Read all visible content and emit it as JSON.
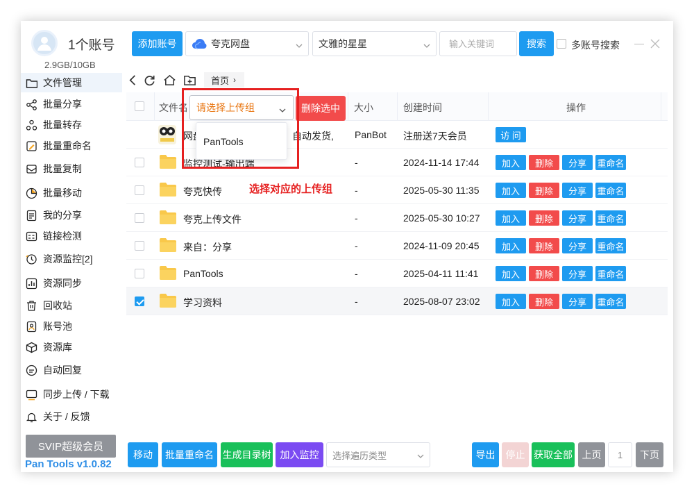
{
  "sidebar": {
    "account_count": "1个账号",
    "storage": "2.9GB/10GB",
    "items": [
      {
        "label": "文件管理",
        "icon": "folder-icon"
      },
      {
        "label": "批量分享",
        "icon": "share-icon"
      },
      {
        "label": "批量转存",
        "icon": "transfer-icon"
      },
      {
        "label": "批量重命名",
        "icon": "rename-icon"
      },
      {
        "label": "批量复制",
        "icon": "copy-icon"
      },
      {
        "label": "批量移动",
        "icon": "move-icon"
      },
      {
        "label": "我的分享",
        "icon": "my-share-icon"
      },
      {
        "label": "链接检测",
        "icon": "link-check-icon"
      },
      {
        "label": "资源监控[2]",
        "icon": "monitor-icon"
      },
      {
        "label": "资源同步",
        "icon": "sync-icon"
      },
      {
        "label": "回收站",
        "icon": "trash-icon"
      },
      {
        "label": "账号池",
        "icon": "account-pool-icon"
      },
      {
        "label": "资源库",
        "icon": "resource-icon"
      },
      {
        "label": "自动回复",
        "icon": "auto-reply-icon"
      },
      {
        "label": "同步上传 / 下载",
        "icon": "upload-download-icon"
      },
      {
        "label": "关于 / 反馈",
        "icon": "bell-icon"
      }
    ],
    "svip_label": "SVIP超级会员",
    "version": "Pan Tools v1.0.82"
  },
  "toolbar": {
    "add_account": "添加账号",
    "drive": "夸克网盘",
    "user": "文雅的星星",
    "keyword_placeholder": "输入关键词",
    "search": "搜索",
    "multi_account": "多账号搜索"
  },
  "breadcrumb": {
    "home": "首页"
  },
  "table": {
    "headers": {
      "name": "文件名",
      "size": "大小",
      "created": "创建时间",
      "actions": "操作"
    },
    "group_select_placeholder": "请选择上传组",
    "delete_selected": "删除选中",
    "dropdown_option": "PanTools",
    "ad_row": {
      "name": "网盘",
      "name_tail": "自动发货,",
      "size": "PanBot",
      "created": "注册送7天会员",
      "action": "访 问"
    },
    "rows": [
      {
        "name": "监控测试-输出端",
        "size": "-",
        "created": "2024-11-14 17:44",
        "checked": false
      },
      {
        "name": "夸克快传",
        "size": "-",
        "created": "2025-05-30 11:35",
        "checked": false
      },
      {
        "name": "夸克上传文件",
        "size": "-",
        "created": "2025-05-30 10:27",
        "checked": false
      },
      {
        "name": "来自：分享",
        "size": "-",
        "created": "2024-11-09 20:45",
        "checked": false
      },
      {
        "name": "PanTools",
        "size": "-",
        "created": "2025-04-11 11:41",
        "checked": false
      },
      {
        "name": "学习资料",
        "size": "-",
        "created": "2025-08-07 23:02",
        "checked": true
      }
    ],
    "row_actions": {
      "join": "加入",
      "delete": "删除",
      "share": "分享",
      "rename": "重命名"
    }
  },
  "annotation": "选择对应的上传组",
  "bottom": {
    "move": "移动",
    "batch_rename": "批量重命名",
    "gen_tree": "生成目录树",
    "add_monitor": "加入监控",
    "traverse_type_placeholder": "选择遍历类型",
    "export": "导出",
    "stop": "停止",
    "get_all": "获取全部",
    "prev": "上页",
    "page": "1",
    "next": "下页"
  },
  "colors": {
    "primary": "#1e9bf0",
    "danger": "#f24b4b",
    "success": "#19c05a",
    "purple": "#7b4bf2",
    "annotation": "#e62020",
    "placeholder_orange": "#e8730c"
  }
}
